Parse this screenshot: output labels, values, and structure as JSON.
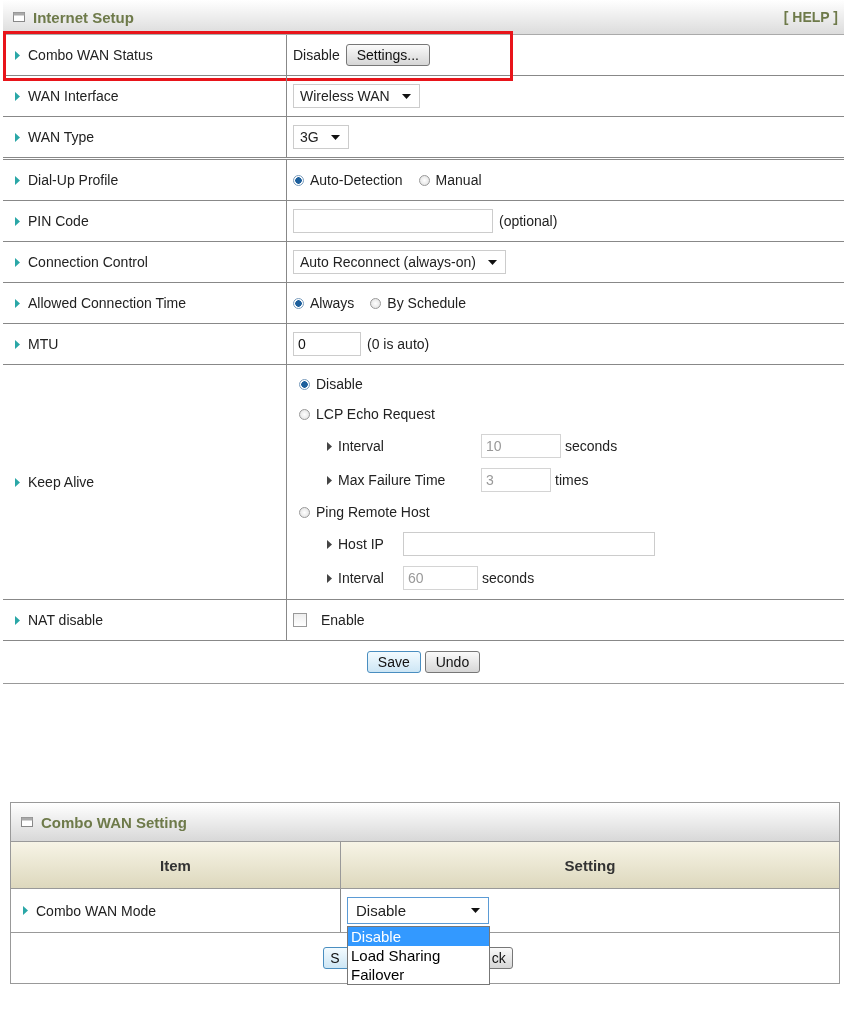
{
  "internet_setup": {
    "title": "Internet Setup",
    "help": "[ HELP ]",
    "rows": [
      {
        "label": "Combo WAN Status",
        "kind": "status",
        "value": "Disable",
        "button": "Settings...",
        "highlighted": true
      },
      {
        "label": "WAN Interface",
        "kind": "select",
        "value": "Wireless WAN"
      },
      {
        "label": "WAN Type",
        "kind": "select",
        "value": "3G"
      },
      {
        "label": "Dial-Up Profile",
        "kind": "radio",
        "options": [
          {
            "label": "Auto-Detection",
            "selected": true
          },
          {
            "label": "Manual",
            "selected": false
          }
        ]
      },
      {
        "label": "PIN Code",
        "kind": "input",
        "note": "(optional)"
      },
      {
        "label": "Connection Control",
        "kind": "select",
        "value": "Auto Reconnect (always-on)"
      },
      {
        "label": "Allowed Connection Time",
        "kind": "radio",
        "options": [
          {
            "label": "Always",
            "selected": true
          },
          {
            "label": "By Schedule",
            "selected": false
          }
        ]
      },
      {
        "label": "MTU",
        "kind": "input",
        "value": "0",
        "note": "(0 is auto)"
      },
      {
        "label": "Keep Alive",
        "kind": "keepalive",
        "groups": [
          {
            "option": {
              "label": "Disable",
              "selected": true
            }
          },
          {
            "option": {
              "label": "LCP Echo Request",
              "selected": false
            },
            "fields": [
              {
                "label": "Interval",
                "value": "10",
                "unit": "seconds",
                "disabled": true
              },
              {
                "label": "Max Failure Time",
                "value": "3",
                "unit": "times",
                "disabled": true
              }
            ]
          },
          {
            "option": {
              "label": "Ping Remote Host",
              "selected": false
            },
            "fields": [
              {
                "label": "Host IP"
              },
              {
                "label": "Interval",
                "value": "60",
                "unit": "seconds",
                "disabled": true
              }
            ]
          }
        ]
      },
      {
        "label": "NAT disable",
        "kind": "checkbox",
        "option": "Enable",
        "checked": false
      }
    ],
    "buttons": [
      "Save",
      "Undo"
    ]
  },
  "combo_wan_setting": {
    "title": "Combo WAN Setting",
    "columns": [
      "Item",
      "Setting"
    ],
    "row": {
      "label": "Combo WAN Mode",
      "value": "Disable",
      "expanded": true,
      "options": [
        {
          "label": "Disable",
          "selected": true
        },
        {
          "label": "Load Sharing",
          "selected": false
        },
        {
          "label": "Failover",
          "selected": false
        }
      ]
    },
    "buttons": [
      "S",
      "ck"
    ]
  }
}
